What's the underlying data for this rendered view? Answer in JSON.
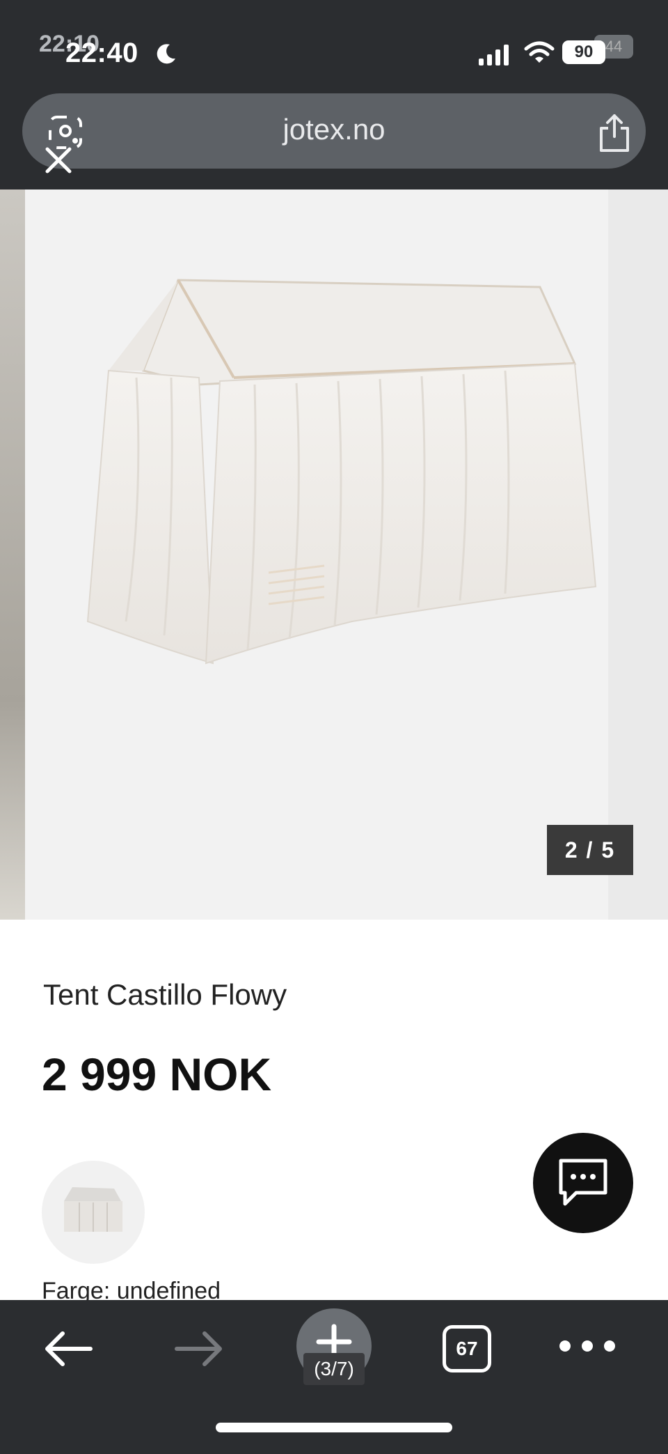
{
  "status_bar": {
    "time": "22:40",
    "time_ghost": "22:10",
    "battery": "90",
    "battery_ghost": "44"
  },
  "browser": {
    "url": "jotex.no"
  },
  "gallery": {
    "counter": "2 / 5"
  },
  "product": {
    "title": "Tent Castillo Flowy",
    "price": "2 999 NOK",
    "color_label": "Farge: undefined"
  },
  "toolbar": {
    "tabs_count": "67",
    "page_indicator": "(3/7)"
  },
  "icons": [
    "moon-icon",
    "signal-icon",
    "wifi-icon",
    "lens-icon",
    "close-icon",
    "share-icon",
    "chat-icon",
    "back-icon",
    "forward-icon",
    "plus-icon",
    "tabs-icon",
    "more-icon"
  ]
}
